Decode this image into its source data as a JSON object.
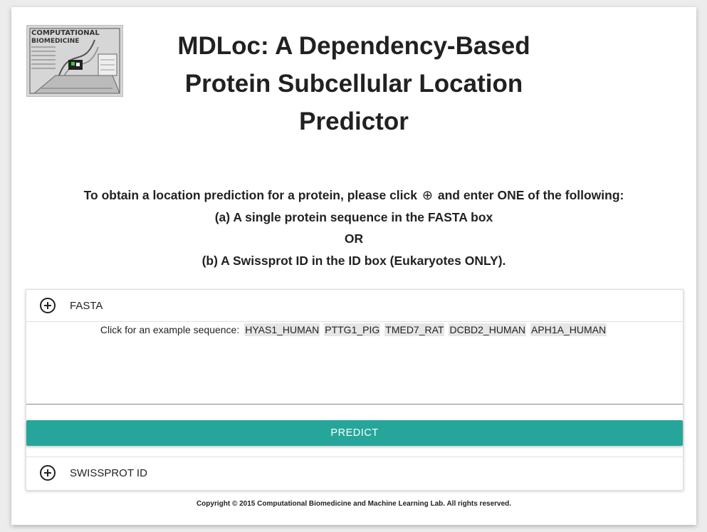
{
  "header": {
    "title_lines": [
      "MDLoc: A Dependency-Based",
      "Protein Subcellular Location",
      "Predictor"
    ],
    "logo_text": [
      "COMPUTATIONAL",
      "BIOMEDICINE"
    ]
  },
  "instructions": {
    "line1_before": "To obtain a location prediction for a protein, please click",
    "line1_icon": "⊕",
    "line1_after": "and enter ONE of the following:",
    "line2": "(a) A single protein sequence in the FASTA box",
    "line3": "OR",
    "line4": "(b) A Swissprot ID in the ID box (Eukaryotes ONLY)."
  },
  "fasta": {
    "label": "FASTA",
    "icon": "add-circle-icon",
    "examples_label": "Click for an example sequence:",
    "examples": [
      "HYAS1_HUMAN",
      "PTTG1_PIG",
      "TMED7_RAT",
      "DCBD2_HUMAN",
      "APH1A_HUMAN"
    ],
    "value": "",
    "predict_label": "PREDICT"
  },
  "swissprot": {
    "label": "SWISSPROT ID",
    "icon": "add-circle-icon"
  },
  "footer": {
    "copyright": "Copyright © 2015 Computational Biomedicine and Machine Learning Lab. All rights reserved."
  },
  "colors": {
    "accent": "#26a69a",
    "background": "#ececec"
  }
}
